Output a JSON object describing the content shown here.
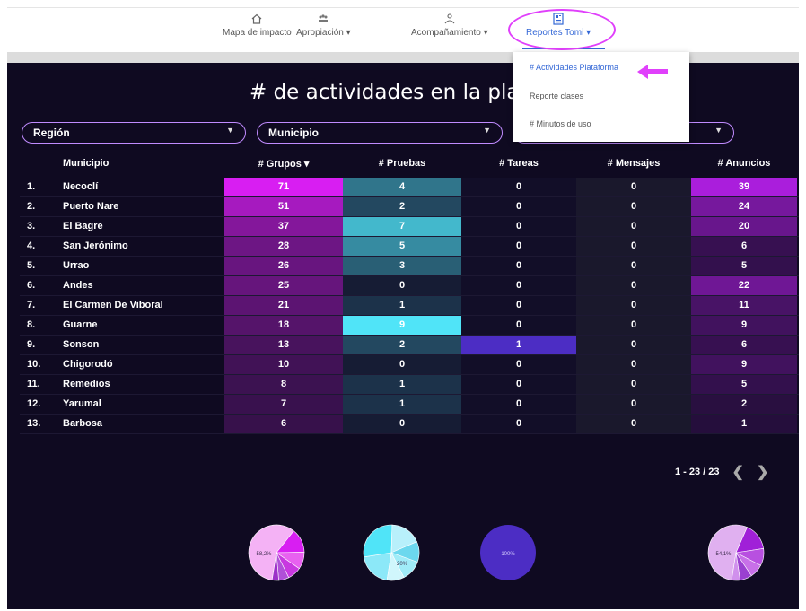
{
  "nav": {
    "items": [
      {
        "label": "Mapa de impacto"
      },
      {
        "label": "Apropiación ▾"
      },
      {
        "label": "Acompañamiento ▾"
      },
      {
        "label": "Reportes Tomi ▾"
      }
    ]
  },
  "dashboard": {
    "title": "# de actividades en la plataf",
    "filters": {
      "region": "Región",
      "municipio": "Municipio"
    },
    "table": {
      "headers": [
        "Municipio",
        "# Grupos ▾",
        "# Pruebas",
        "# Tareas",
        "# Mensajes",
        "# Anuncios"
      ],
      "rows": [
        {
          "idx": "1.",
          "municipio": "Necoclí",
          "grupos": 71,
          "pruebas": 4,
          "tareas": 0,
          "mensajes": 0,
          "anuncios": 39
        },
        {
          "idx": "2.",
          "municipio": "Puerto Nare",
          "grupos": 51,
          "pruebas": 2,
          "tareas": 0,
          "mensajes": 0,
          "anuncios": 24
        },
        {
          "idx": "3.",
          "municipio": "El Bagre",
          "grupos": 37,
          "pruebas": 7,
          "tareas": 0,
          "mensajes": 0,
          "anuncios": 20
        },
        {
          "idx": "4.",
          "municipio": "San Jerónimo",
          "grupos": 28,
          "pruebas": 5,
          "tareas": 0,
          "mensajes": 0,
          "anuncios": 6
        },
        {
          "idx": "5.",
          "municipio": "Urrao",
          "grupos": 26,
          "pruebas": 3,
          "tareas": 0,
          "mensajes": 0,
          "anuncios": 5
        },
        {
          "idx": "6.",
          "municipio": "Andes",
          "grupos": 25,
          "pruebas": 0,
          "tareas": 0,
          "mensajes": 0,
          "anuncios": 22
        },
        {
          "idx": "7.",
          "municipio": "El Carmen De Viboral",
          "grupos": 21,
          "pruebas": 1,
          "tareas": 0,
          "mensajes": 0,
          "anuncios": 11
        },
        {
          "idx": "8.",
          "municipio": "Guarne",
          "grupos": 18,
          "pruebas": 9,
          "tareas": 0,
          "mensajes": 0,
          "anuncios": 9
        },
        {
          "idx": "9.",
          "municipio": "Sonson",
          "grupos": 13,
          "pruebas": 2,
          "tareas": 1,
          "mensajes": 0,
          "anuncios": 6
        },
        {
          "idx": "10.",
          "municipio": "Chigorodó",
          "grupos": 10,
          "pruebas": 0,
          "tareas": 0,
          "mensajes": 0,
          "anuncios": 9
        },
        {
          "idx": "11.",
          "municipio": "Remedios",
          "grupos": 8,
          "pruebas": 1,
          "tareas": 0,
          "mensajes": 0,
          "anuncios": 5
        },
        {
          "idx": "12.",
          "municipio": "Yarumal",
          "grupos": 7,
          "pruebas": 1,
          "tareas": 0,
          "mensajes": 0,
          "anuncios": 2
        },
        {
          "idx": "13.",
          "municipio": "Barbosa",
          "grupos": 6,
          "pruebas": 0,
          "tareas": 0,
          "mensajes": 0,
          "anuncios": 1
        }
      ]
    },
    "pagination": "1 - 23 / 23",
    "pies": [
      {
        "label": "58,2%",
        "shares": [
          0.582,
          0.14,
          0.1,
          0.08,
          0.06,
          0.038
        ],
        "colors": [
          "#f4b2f5",
          "#d81ef2",
          "#e860f0",
          "#c838e0",
          "#b050d8",
          "#9c30c8"
        ]
      },
      {
        "label": "20%",
        "shares": [
          0.2,
          0.28,
          0.18,
          0.12,
          0.12,
          0.1
        ],
        "colors": [
          "#8ce8f8",
          "#50e4f8",
          "#b8f0fb",
          "#6cd8ee",
          "#a0ecf8",
          "#d0f6fc"
        ]
      },
      {
        "label": "100%",
        "shares": [
          1.0
        ],
        "colors": [
          "#4c2dc4"
        ]
      },
      {
        "label": "54,1%",
        "shares": [
          0.541,
          0.16,
          0.1,
          0.08,
          0.07,
          0.049
        ],
        "colors": [
          "#e0b0f0",
          "#a020d8",
          "#b850e0",
          "#c870e8",
          "#9a40d0",
          "#d090ec"
        ]
      }
    ]
  },
  "menu": {
    "items": [
      {
        "label": "# Actividades Plataforma"
      },
      {
        "label": "Reporte clases"
      },
      {
        "label": "# Minutos de uso"
      }
    ]
  },
  "colors": {
    "background": "#0f0a21",
    "accent": "#3367d6",
    "highlight": "#e040fb"
  }
}
